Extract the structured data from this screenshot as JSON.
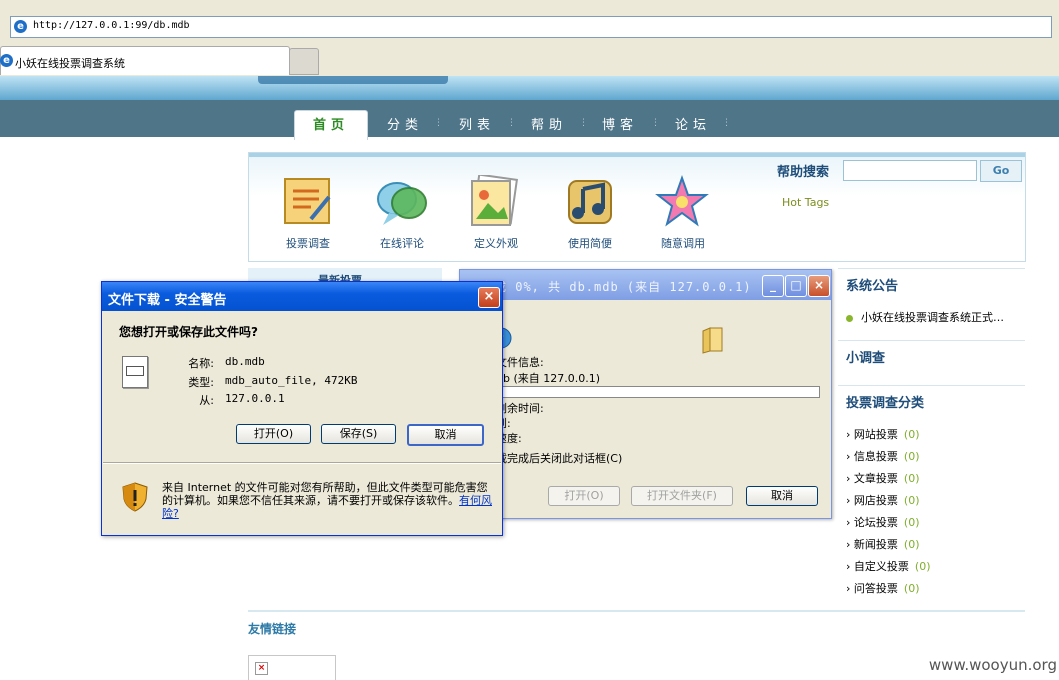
{
  "browser": {
    "url": "http://127.0.0.1:99/db.mdb",
    "tab_title": "小妖在线投票调查系统"
  },
  "site": {
    "nav": [
      "首页",
      "分类",
      "列表",
      "帮助",
      "博客",
      "论坛"
    ],
    "quick_links": [
      "投票调查",
      "在线评论",
      "定义外观",
      "使用简便",
      "随意调用"
    ],
    "help_search_label": "帮助搜索",
    "help_go": "Go",
    "hot_tags": "Hot Tags",
    "left_panel_title": "最新投票",
    "announce_title": "系统公告",
    "announce_item": "小妖在线投票调查系统正式…",
    "small_survey_title": "小调查",
    "category_title": "投票调查分类",
    "categories": [
      {
        "name": "网站投票",
        "count": "(0)"
      },
      {
        "name": "信息投票",
        "count": "(0)"
      },
      {
        "name": "文章投票",
        "count": "(0)"
      },
      {
        "name": "网店投票",
        "count": "(0)"
      },
      {
        "name": "论坛投票",
        "count": "(0)"
      },
      {
        "name": "新闻投票",
        "count": "(0)"
      },
      {
        "name": "自定义投票",
        "count": "(0)"
      },
      {
        "name": "问答投票",
        "count": "(0)"
      }
    ],
    "friend_links_title": "友情链接",
    "watermark": "www.wooyun.org"
  },
  "progress_dialog": {
    "title": "已完成 0%, 共 db.mdb (来自 127.0.0.1)",
    "file_info_label": "文件信息:",
    "file_info_value": "db (来自 127.0.0.1)",
    "remaining_label": "剩余时间:",
    "to_label": "到:",
    "speed_label": "速度:",
    "auto_close_label": "载完成后关闭此对话框(C)",
    "open_button": "打开(O)",
    "open_folder_button": "打开文件夹(F)",
    "cancel_button": "取消",
    "progress": 0
  },
  "security_dialog": {
    "title": "文件下载 - 安全警告",
    "question": "您想打开或保存此文件吗?",
    "name_label": "名称:",
    "name_value": "db.mdb",
    "type_label": "类型:",
    "type_value": "mdb_auto_file, 472KB",
    "from_label": "从:",
    "from_value": "127.0.0.1",
    "open_button": "打开(O)",
    "save_button": "保存(S)",
    "cancel_button": "取消",
    "warning_text": "来自 Internet 的文件可能对您有所帮助，但此文件类型可能危害您的计算机。如果您不信任其来源，请不要打开或保存该软件。",
    "risk_link": "有何风险?"
  },
  "colors": {
    "nav_bar": "#4f7589",
    "xp_title_blue": "#0a5bde",
    "link_blue": "#1f4d7a",
    "count_green": "#7fae2d"
  }
}
